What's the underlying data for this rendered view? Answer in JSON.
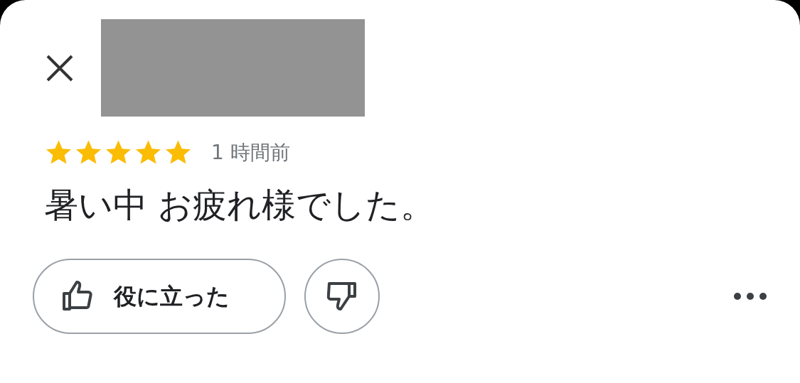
{
  "review": {
    "stars": 5,
    "time": "1 時間前",
    "text": "暑い中 お疲れ様でした。"
  },
  "actions": {
    "helpful": "役に立った"
  }
}
